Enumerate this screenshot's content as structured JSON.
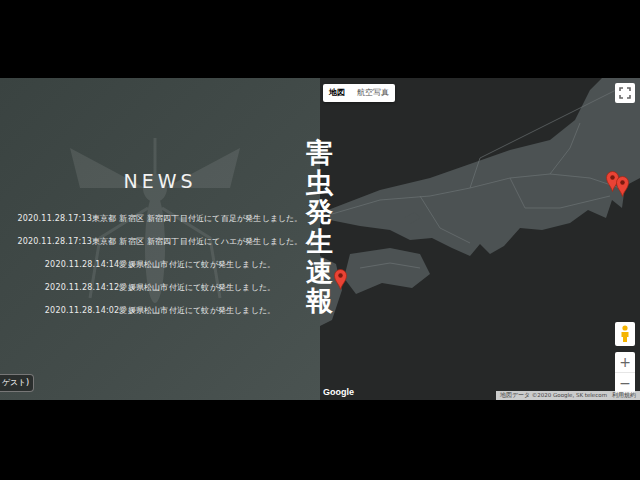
{
  "news": {
    "title": "NEWS",
    "items": [
      "2020.11.28.17:13東京都 新宿区 新宿四丁目付近にて百足が発生しました。",
      "2020.11.28.17:13東京都 新宿区 新宿四丁目付近にてハエが発生しました。",
      "2020.11.28.14:14愛媛県松山市付近にて蚊が発生しました。",
      "2020.11.28.14:12愛媛県松山市付近にて蚊が発生しました。",
      "2020.11.28.14:02愛媛県松山市付近にて蚊が発生しました。"
    ]
  },
  "headline": "害虫発生速報",
  "guest_tab": "ゲスト)",
  "map": {
    "type_buttons": [
      {
        "label": "地図",
        "selected": true
      },
      {
        "label": "航空写真",
        "selected": false
      }
    ],
    "zoom": [
      "+",
      "−"
    ],
    "logo": "Google",
    "attribution": "地図データ ©2020 Google, SK telecom",
    "terms": "利用規約",
    "pins": [
      {
        "lat": 33.84,
        "lon": 132.77
      },
      {
        "lat": 35.69,
        "lon": 139.7
      },
      {
        "lat": 35.6,
        "lon": 139.95
      }
    ]
  }
}
